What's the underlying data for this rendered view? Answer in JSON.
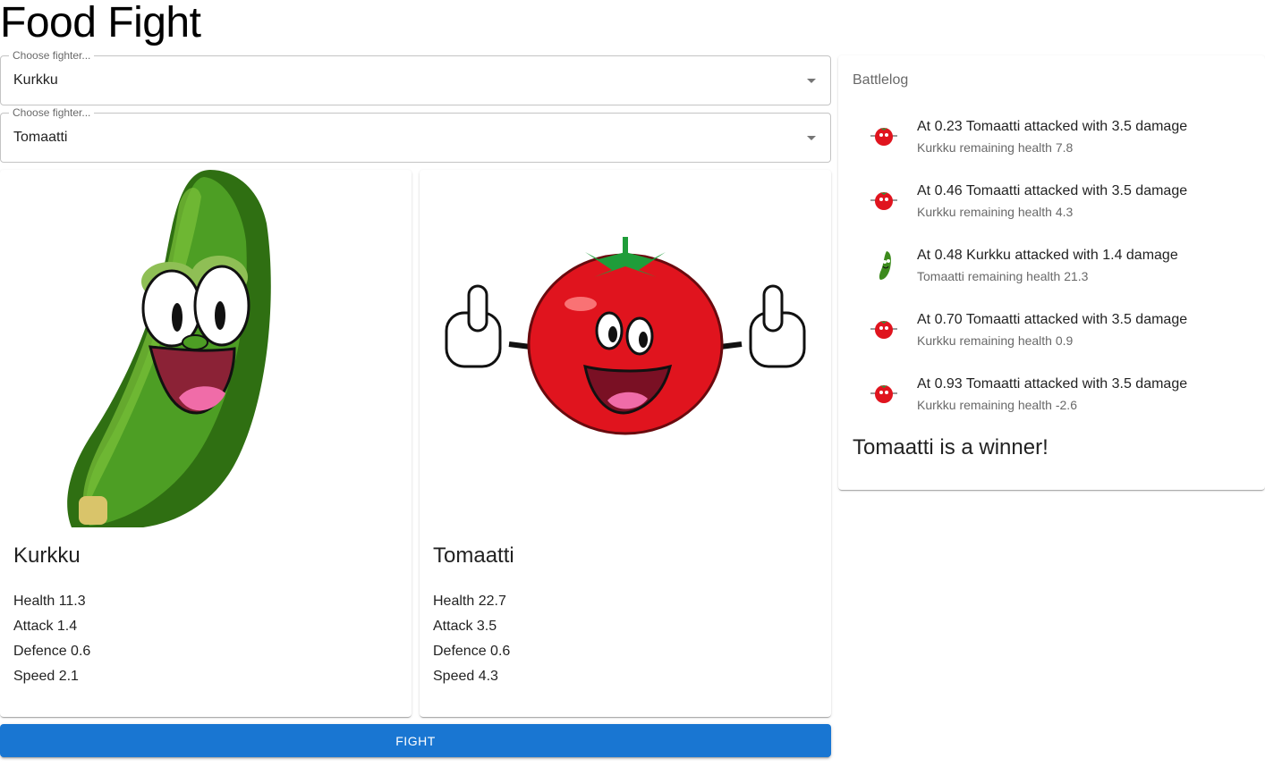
{
  "app": {
    "title": "Food Fight"
  },
  "selects": [
    {
      "label": "Choose fighter...",
      "value": "Kurkku"
    },
    {
      "label": "Choose fighter...",
      "value": "Tomaatti"
    }
  ],
  "fighters": [
    {
      "name": "Kurkku",
      "health": "Health 11.3",
      "attack": "Attack 1.4",
      "defence": "Defence 0.6",
      "speed": "Speed 2.1",
      "image": "cucumber-character"
    },
    {
      "name": "Tomaatti",
      "health": "Health 22.7",
      "attack": "Attack 3.5",
      "defence": "Defence 0.6",
      "speed": "Speed 4.3",
      "image": "tomato-character"
    }
  ],
  "fight_button": {
    "label": "FIGHT"
  },
  "battlelog": {
    "title": "Battlelog",
    "entries": [
      {
        "avatar": "tomato-icon",
        "primary": "At 0.23 Tomaatti attacked with 3.5 damage",
        "secondary": "Kurkku remaining health 7.8"
      },
      {
        "avatar": "tomato-icon",
        "primary": "At 0.46 Tomaatti attacked with 3.5 damage",
        "secondary": "Kurkku remaining health 4.3"
      },
      {
        "avatar": "cucumber-icon",
        "primary": "At 0.48 Kurkku attacked with 1.4 damage",
        "secondary": "Tomaatti remaining health 21.3"
      },
      {
        "avatar": "tomato-icon",
        "primary": "At 0.70 Tomaatti attacked with 3.5 damage",
        "secondary": "Kurkku remaining health 0.9"
      },
      {
        "avatar": "tomato-icon",
        "primary": "At 0.93 Tomaatti attacked with 3.5 damage",
        "secondary": "Kurkku remaining health -2.6"
      }
    ],
    "winner": "Tomaatti is a winner!"
  },
  "colors": {
    "primary": "#1976d2",
    "tomato": "#e0141e",
    "cucumber": "#3d8b1d"
  }
}
